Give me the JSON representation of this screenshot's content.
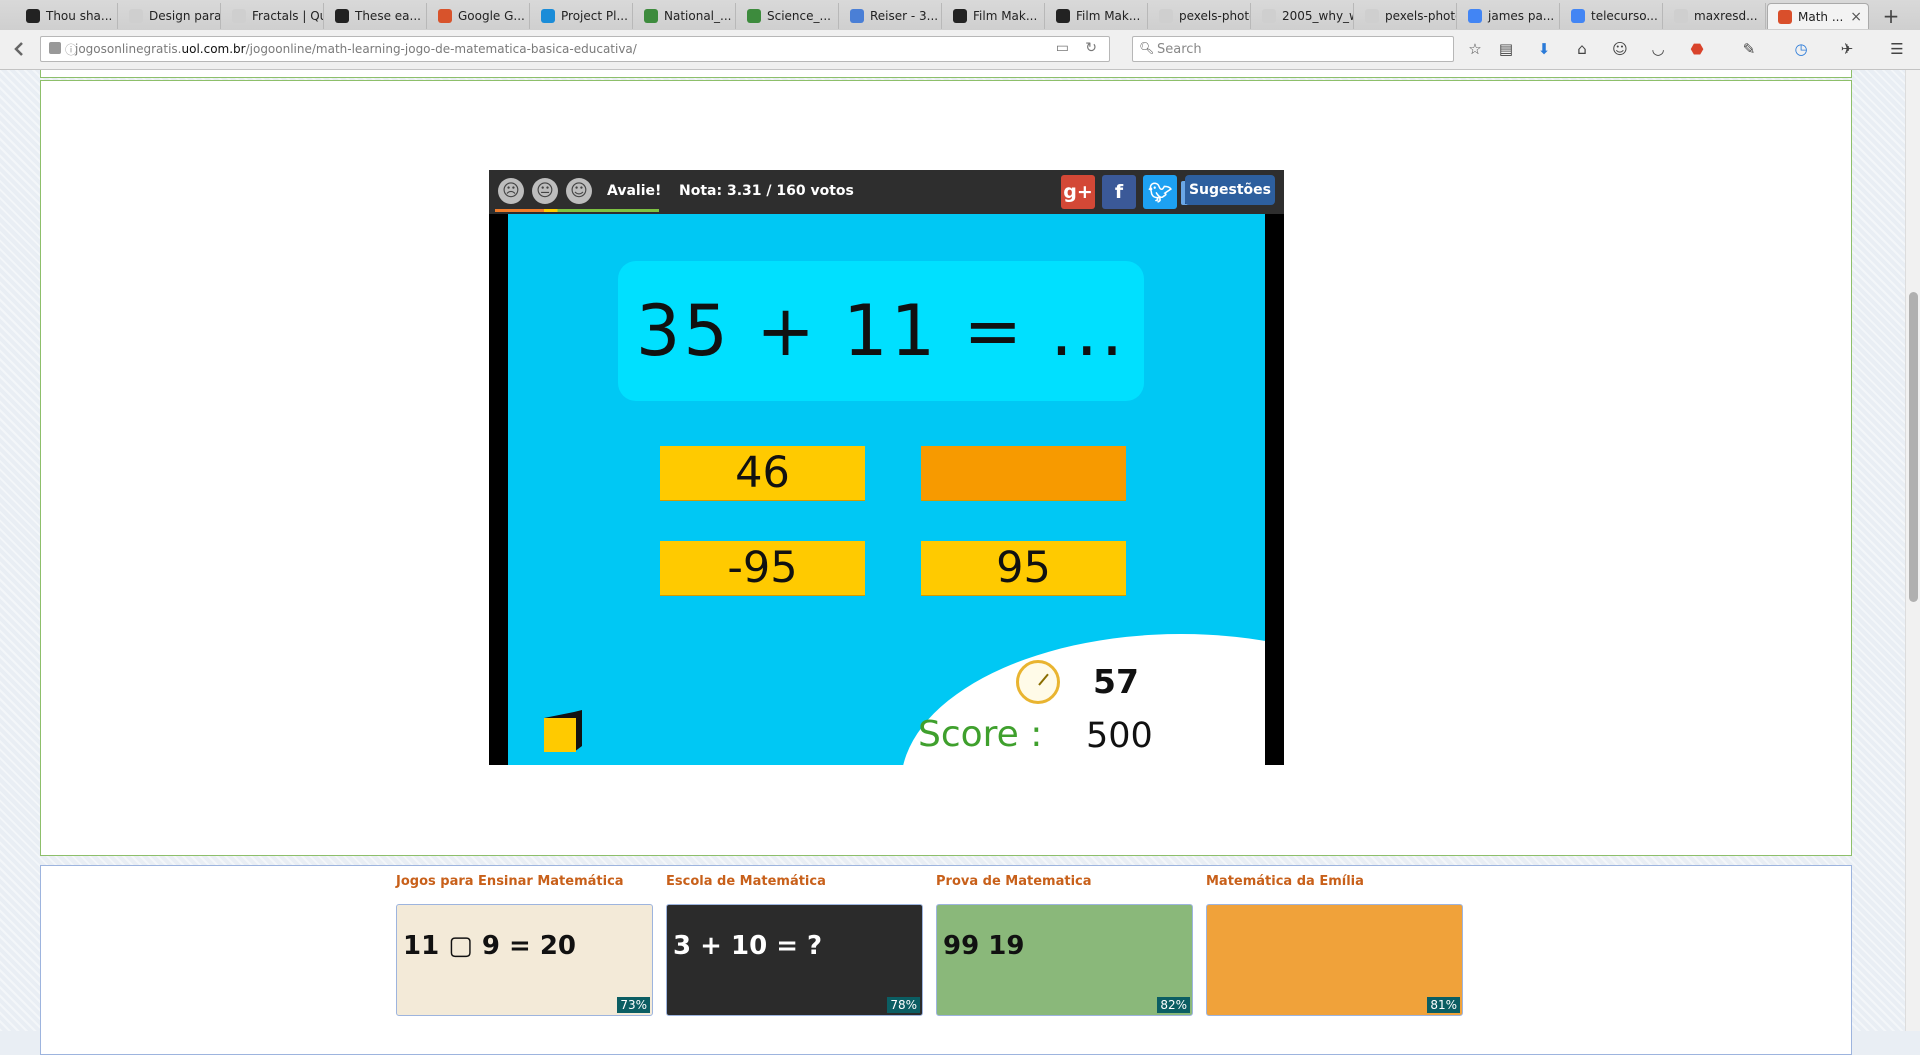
{
  "browser": {
    "tabs": [
      {
        "label": "Thou sha...",
        "color": "#222222"
      },
      {
        "label": "Design para ...",
        "color": "#cfcfcf"
      },
      {
        "label": "Fractals | Qu...",
        "color": "#cfcfcf"
      },
      {
        "label": "These ea...",
        "color": "#222222"
      },
      {
        "label": "Google G...",
        "color": "#d8532b"
      },
      {
        "label": "Project Pl...",
        "color": "#1a8cd8"
      },
      {
        "label": "National_...",
        "color": "#3d8b3d"
      },
      {
        "label": "Science_...",
        "color": "#3d8b3d"
      },
      {
        "label": "Reiser - 3...",
        "color": "#4a7fd6"
      },
      {
        "label": "Film Mak...",
        "color": "#222222"
      },
      {
        "label": "Film Mak...",
        "color": "#222222"
      },
      {
        "label": "pexels-photo...",
        "color": "#cfcfcf"
      },
      {
        "label": "2005_why_w...",
        "color": "#cfcfcf"
      },
      {
        "label": "pexels-photo...",
        "color": "#cfcfcf"
      },
      {
        "label": "james pa...",
        "color": "#4285f4"
      },
      {
        "label": "telecurso...",
        "color": "#4285f4"
      },
      {
        "label": "maxresd...",
        "color": "#cfcfcf"
      },
      {
        "label": "Math ...",
        "color": "#d94f2b",
        "active": true
      }
    ],
    "url_prefix": "jogosonlinegratis.",
    "url_domain": "uol.com.br",
    "url_path": "/jogoonline/math-learning-jogo-de-matematica-basica-educativa/",
    "search_placeholder": "Search"
  },
  "game_header": {
    "avalie": "Avalie!",
    "nota": "Nota: 3.31 / 160 votos",
    "sugestoes": "Sugestões"
  },
  "game": {
    "question": "35 + 11 = ...",
    "answers": [
      "46",
      "",
      "-95",
      "95"
    ],
    "highlighted_answer": 1,
    "timer": "57",
    "score_label": "Score :",
    "score": "500"
  },
  "related": [
    {
      "title": "Jogos para Ensinar Matemática",
      "rating": "73%",
      "thumb_text": "11 ▢ 9 = 20"
    },
    {
      "title": "Escola de Matemática",
      "rating": "78%",
      "thumb_text": "3 + 10 = ?"
    },
    {
      "title": "Prova de Matematica",
      "rating": "82%",
      "thumb_text": "99 19"
    },
    {
      "title": "Matemática da Emília",
      "rating": "81%",
      "thumb_text": ""
    }
  ],
  "colors": {
    "game_bg": "#00c8f4",
    "answer": "#ffca00",
    "answer_highlight": "#f79a00",
    "score_label": "#3fa02d",
    "related_title": "#c8601a"
  }
}
